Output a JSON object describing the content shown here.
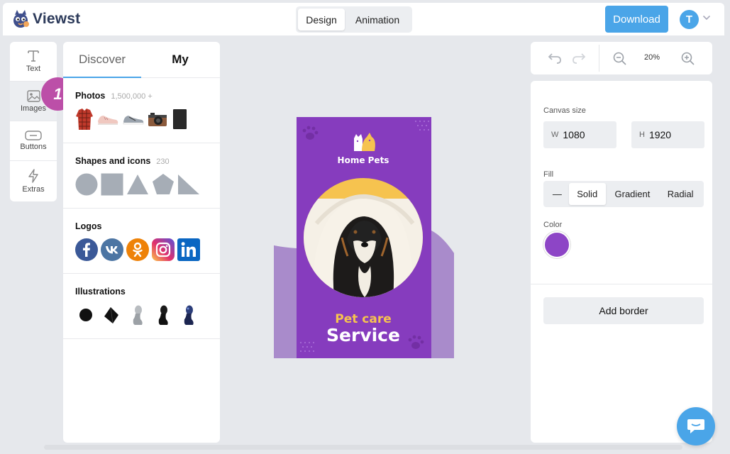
{
  "app": {
    "name": "Viewst"
  },
  "header": {
    "modes": [
      {
        "label": "Design",
        "active": true
      },
      {
        "label": "Animation",
        "active": false
      }
    ],
    "download_label": "Download",
    "avatar_initial": "T"
  },
  "rail": {
    "items": [
      {
        "label": "Text",
        "icon": "text-icon"
      },
      {
        "label": "Images",
        "icon": "image-icon",
        "active": true
      },
      {
        "label": "Buttons",
        "icon": "button-icon"
      },
      {
        "label": "Extras",
        "icon": "lightning-icon"
      }
    ]
  },
  "step_badge": "1",
  "assets": {
    "tabs": {
      "discover": "Discover",
      "my": "My"
    },
    "sections": {
      "photos": {
        "title": "Photos",
        "count": "1,500,000 +"
      },
      "shapes": {
        "title": "Shapes and icons",
        "count": "230"
      },
      "logos": {
        "title": "Logos",
        "items": [
          "facebook-icon",
          "vk-icon",
          "ok-icon",
          "instagram-icon",
          "linkedin-icon"
        ]
      },
      "illustrations": {
        "title": "Illustrations"
      }
    }
  },
  "canvas": {
    "brand": "Home Pets",
    "headline_small": "Pet care",
    "headline_big": "Service",
    "colors": {
      "background": "#8a3fc2",
      "accent": "#f6c34f",
      "wave": "#a98bcb"
    }
  },
  "history": {
    "zoom": "20%"
  },
  "props": {
    "canvas_size_label": "Canvas size",
    "width": {
      "prefix": "W",
      "value": "1080"
    },
    "height": {
      "prefix": "H",
      "value": "1920"
    },
    "fill_label": "Fill",
    "fill_options": [
      {
        "label": "—",
        "active": false
      },
      {
        "label": "Solid",
        "active": true
      },
      {
        "label": "Gradient",
        "active": false
      },
      {
        "label": "Radial",
        "active": false
      }
    ],
    "color_label": "Color",
    "color_value": "#8d45c6",
    "add_border_label": "Add border"
  },
  "theme": {
    "accent": "#4aa5e8",
    "badge": "#bc4fa8"
  }
}
